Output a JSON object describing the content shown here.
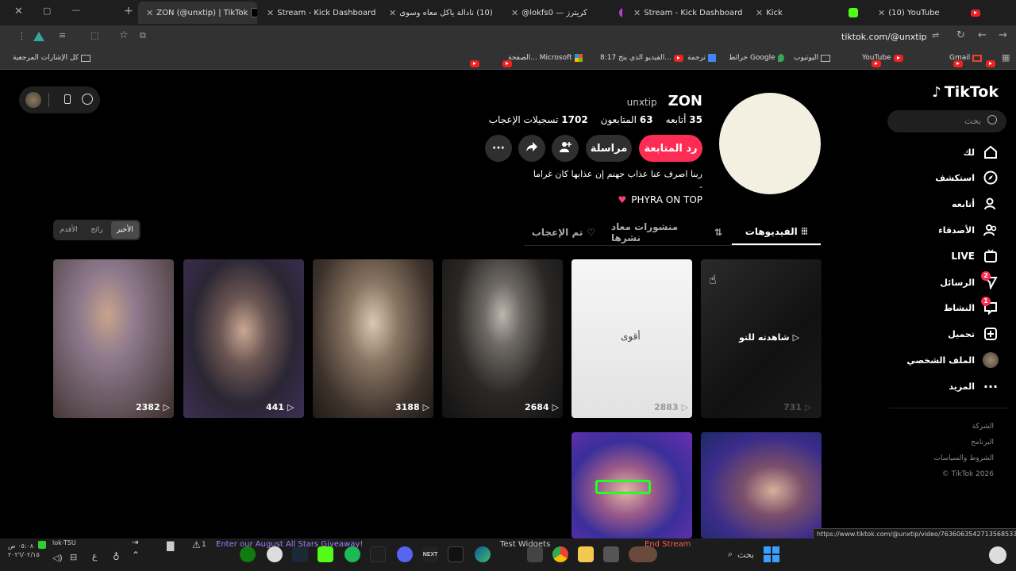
{
  "tabs": [
    {
      "label": "ZON (@unxtip) | TikTok",
      "active": true
    },
    {
      "label": "Stream - Kick Dashboard"
    },
    {
      "label": "(10) نادالة ياكل معاه وسوى"
    },
    {
      "label": "@lokfs0 — كريترز"
    },
    {
      "label": "Stream - Kick Dashboard"
    },
    {
      "label": "Kick"
    },
    {
      "label": "(10) YouTube"
    }
  ],
  "address": {
    "url": "tiktok.com/@unxtip"
  },
  "bookmarks": {
    "all": "كل الإشارات المرجعية",
    "items": [
      "الصفحة... Microsoft",
      "8:17 الفيديو الذي يتح...",
      "ترجمة",
      "خرائط Google",
      "اليوتيوب",
      "YouTube",
      "Gmail"
    ]
  },
  "sidebar": {
    "logo": "TikTok",
    "search_placeholder": "بحث",
    "items": [
      "لك",
      "استكشف",
      "أتابعه",
      "الأصدقاء",
      "LIVE",
      "الرسائل",
      "النشاط",
      "تحميل",
      "الملف الشخصي",
      "المزيد"
    ],
    "badges": {
      "messages": "2",
      "activity": "1"
    },
    "footer": [
      "الشركة",
      "البرنامج",
      "الشروط والسياسات",
      "© TikTok 2026"
    ]
  },
  "profile": {
    "name": "ZON",
    "handle": "unxtip",
    "following_count": "35",
    "following_label": "أتابعه",
    "followers_count": "63",
    "followers_label": "المتابعون",
    "likes_count": "1702",
    "likes_label": "تسجيلات الإعجاب",
    "follow_back": "رد المتابعة",
    "message": "مراسلة",
    "bio_line1": "ربنا اصرف عنا عذاب جهنم إن عذابها كان غراما",
    "bio_line2": "-",
    "bio_line3": "PHYRA ON TOP"
  },
  "tabs_profile": {
    "videos": "الفيديوهات",
    "reposts": "منشورات معاد نشرها",
    "liked": "تم الإعجاب"
  },
  "sort": [
    "الأخير",
    "رائج",
    "الأقدم"
  ],
  "videos": [
    {
      "views": "731",
      "overlay": "شاهدته للتو"
    },
    {
      "views": "2883",
      "text": "أقوى"
    },
    {
      "views": "2684"
    },
    {
      "views": "3188"
    },
    {
      "views": "441"
    },
    {
      "views": "2382"
    }
  ],
  "status_url": "https://www.tiktok.com/@unxtip/video/7636063542713568533",
  "taskbar": {
    "search": "بحث",
    "test_widgets": "Test Widgets",
    "end_stream": "End Stream",
    "giveaway": "Enter our August All Stars Giveaway!",
    "user": "lok-TSU",
    "time": "٠٥:٠٨ ص",
    "date": "٢٠٢٦/٠٢/١٥",
    "lang": "ع",
    "alerts": "1"
  }
}
